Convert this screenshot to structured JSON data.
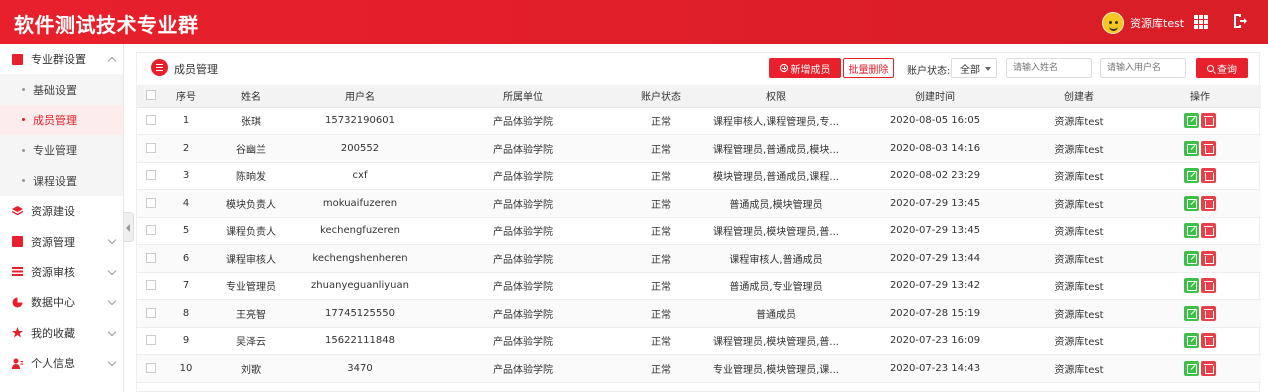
{
  "header": {
    "title": "软件测试技术专业群",
    "user_name": "资源库test"
  },
  "sidebar": {
    "groups": [
      {
        "label": "专业群设置",
        "icon": "document-icon",
        "expanded": true,
        "children": [
          {
            "label": "基础设置",
            "active": false
          },
          {
            "label": "成员管理",
            "active": true
          },
          {
            "label": "专业管理",
            "active": false
          },
          {
            "label": "课程设置",
            "active": false
          }
        ]
      },
      {
        "label": "资源建设",
        "icon": "layers-icon"
      },
      {
        "label": "资源管理",
        "icon": "folder-icon"
      },
      {
        "label": "资源审核",
        "icon": "list-icon"
      },
      {
        "label": "数据中心",
        "icon": "pie-chart-icon"
      },
      {
        "label": "我的收藏",
        "icon": "star-icon"
      },
      {
        "label": "个人信息",
        "icon": "user-icon"
      }
    ]
  },
  "toolbar": {
    "section_title": "成员管理",
    "add_label": "新增成员",
    "batch_delete_label": "批量删除",
    "status_label": "账户状态:",
    "status_value": "全部",
    "name_placeholder": "请输入姓名",
    "username_placeholder": "请输入用户名",
    "query_label": "查询"
  },
  "table": {
    "columns": [
      "序号",
      "姓名",
      "用户名",
      "所属单位",
      "账户状态",
      "权限",
      "创建时间",
      "创建者",
      "操作"
    ],
    "rows": [
      {
        "no": "1",
        "name": "张琪",
        "username": "15732190601",
        "unit": "产品体验学院",
        "status": "正常",
        "perm": "课程审核人,课程管理员,专...",
        "created": "2020-08-05 16:05",
        "creator": "资源库test"
      },
      {
        "no": "2",
        "name": "谷幽兰",
        "username": "200552",
        "unit": "产品体验学院",
        "status": "正常",
        "perm": "课程管理员,普通成员,模块...",
        "created": "2020-08-03 14:16",
        "creator": "资源库test"
      },
      {
        "no": "3",
        "name": "陈晌发",
        "username": "cxf",
        "unit": "产品体验学院",
        "status": "正常",
        "perm": "模块管理员,普通成员,课程...",
        "created": "2020-08-02 23:29",
        "creator": "资源库test"
      },
      {
        "no": "4",
        "name": "模块负责人",
        "username": "mokuaifuzeren",
        "unit": "产品体验学院",
        "status": "正常",
        "perm": "普通成员,模块管理员",
        "created": "2020-07-29 13:45",
        "creator": "资源库test"
      },
      {
        "no": "5",
        "name": "课程负责人",
        "username": "kechengfuzeren",
        "unit": "产品体验学院",
        "status": "正常",
        "perm": "课程管理员,模块管理员,普...",
        "created": "2020-07-29 13:45",
        "creator": "资源库test"
      },
      {
        "no": "6",
        "name": "课程审核人",
        "username": "kechengshenheren",
        "unit": "产品体验学院",
        "status": "正常",
        "perm": "课程审核人,普通成员",
        "created": "2020-07-29 13:44",
        "creator": "资源库test"
      },
      {
        "no": "7",
        "name": "专业管理员",
        "username": "zhuanyeguanliyuan",
        "unit": "产品体验学院",
        "status": "正常",
        "perm": "普通成员,专业管理员",
        "created": "2020-07-29 13:42",
        "creator": "资源库test"
      },
      {
        "no": "8",
        "name": "王亮智",
        "username": "17745125550",
        "unit": "产品体验学院",
        "status": "正常",
        "perm": "普通成员",
        "created": "2020-07-28 15:19",
        "creator": "资源库test"
      },
      {
        "no": "9",
        "name": "吴泽云",
        "username": "15622111848",
        "unit": "产品体验学院",
        "status": "正常",
        "perm": "课程管理员,模块管理员,普...",
        "created": "2020-07-23 16:09",
        "creator": "资源库test"
      },
      {
        "no": "10",
        "name": "刘歌",
        "username": "3470",
        "unit": "产品体验学院",
        "status": "正常",
        "perm": "专业管理员,模块管理员,课...",
        "created": "2020-07-23 14:43",
        "creator": "资源库test"
      }
    ]
  }
}
